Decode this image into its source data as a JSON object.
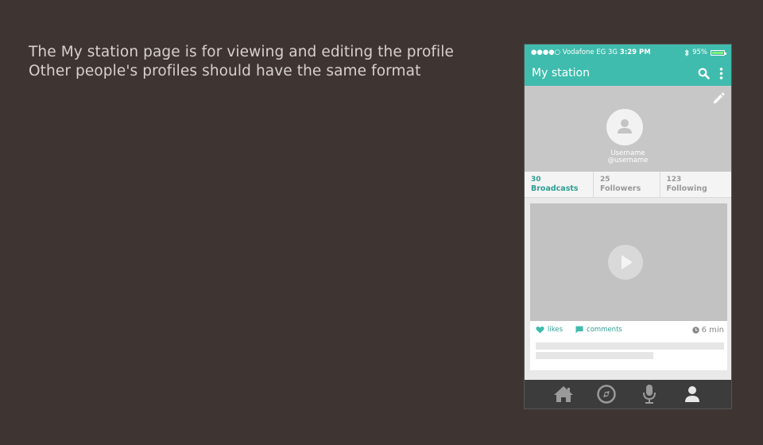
{
  "note": {
    "line1": "The My station page is for viewing and editing the profile",
    "line2": "Other people's profiles should have the same format"
  },
  "status_bar": {
    "carrier": "●●●●○ Vodafone EG  3G",
    "time": "3:29 PM",
    "bluetooth_icon": "bluetooth-icon",
    "battery": "95%"
  },
  "app_bar": {
    "title": "My station",
    "icons": [
      "search-icon",
      "more-vertical-icon"
    ]
  },
  "profile": {
    "username": "Username",
    "handle": "@username",
    "edit_icon": "pencil-icon"
  },
  "stats": [
    {
      "count": "30",
      "label": "Broadcasts"
    },
    {
      "count": "25",
      "label": "Followers"
    },
    {
      "count": "123",
      "label": "Following"
    }
  ],
  "card": {
    "likes": "likes",
    "comments": "comments",
    "duration": "6 min"
  },
  "tab_bar": {
    "icons": [
      "home-icon",
      "explore-icon",
      "microphone-icon",
      "profile-icon"
    ]
  },
  "colors": {
    "background": "#3e3533",
    "accent": "#3fbcad",
    "accent_dark": "#2e9d92",
    "tab_bar": "#3c3c3c"
  }
}
